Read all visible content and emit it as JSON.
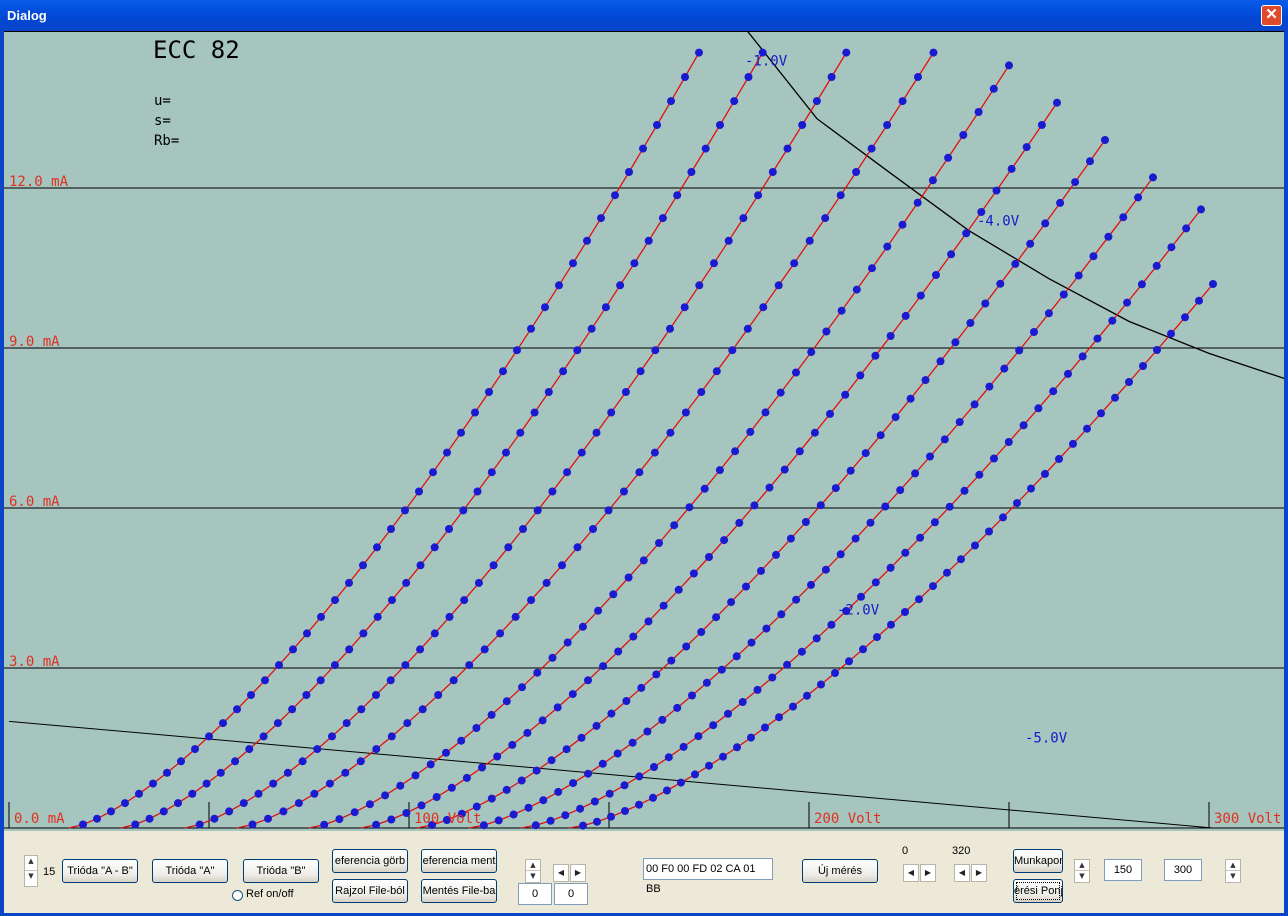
{
  "window": {
    "title": "Dialog"
  },
  "chart_data": {
    "type": "line",
    "title": "ECC 82",
    "params": {
      "u": "u=",
      "s": "s=",
      "rb": "Rb="
    },
    "xlim": [
      0,
      320
    ],
    "ylim": [
      0,
      15
    ],
    "x_ticks": [
      0,
      50,
      100,
      150,
      200,
      250,
      300
    ],
    "x_tick_labels": [
      {
        "x": 0,
        "label": "0.0 mA"
      },
      {
        "x": 100,
        "label": "100 Volt"
      },
      {
        "x": 200,
        "label": "200 Volt"
      },
      {
        "x": 300,
        "label": "300 Volt"
      }
    ],
    "y_gridlines": [
      {
        "y": 3,
        "label": "3.0 mA"
      },
      {
        "y": 6,
        "label": "6.0 mA"
      },
      {
        "y": 9,
        "label": "9.0 mA"
      },
      {
        "y": 12,
        "label": "12.0 mA"
      }
    ],
    "series": [
      {
        "x0": 15,
        "x_end": 176,
        "y_end": 15
      },
      {
        "x0": 28,
        "x_end": 192,
        "y_end": 15
      },
      {
        "x0": 44,
        "x_end": 213,
        "y_end": 15
      },
      {
        "x0": 57,
        "x_end": 235,
        "y_end": 15
      },
      {
        "x0": 75,
        "x_end": 250,
        "y_end": 14.3
      },
      {
        "x0": 88,
        "x_end": 262,
        "y_end": 13.6
      },
      {
        "x0": 102,
        "x_end": 274,
        "y_end": 12.9
      },
      {
        "x0": 115,
        "x_end": 286,
        "y_end": 12.2
      },
      {
        "x0": 128,
        "x_end": 298,
        "y_end": 11.6
      },
      {
        "x0": 140,
        "x_end": 301,
        "y_end": 10.2
      }
    ],
    "annotations": [
      {
        "text": "-1.0V",
        "x": 184,
        "y": 14.3
      },
      {
        "text": "-4.0V",
        "x": 242,
        "y": 11.3
      },
      {
        "text": "-2.0V",
        "x": 207,
        "y": 4.0
      },
      {
        "text": "-5.0V",
        "x": 254,
        "y": 1.6
      }
    ],
    "load_line": {
      "x": [
        0,
        301
      ],
      "y": [
        2.0,
        0
      ]
    },
    "power_curve": [
      [
        184,
        15
      ],
      [
        202,
        13.3
      ],
      [
        220,
        12.3
      ],
      [
        240,
        11.2
      ],
      [
        260,
        10.3
      ],
      [
        280,
        9.5
      ],
      [
        300,
        8.9
      ],
      [
        320,
        8.4
      ]
    ],
    "colors": {
      "background": "#a6c5bf",
      "curve": "#e01010",
      "marker": "#1a1ad0",
      "axis_label": "#e03020",
      "annotation": "#1818c8",
      "grid": "#000000"
    }
  },
  "controls": {
    "spin_value": "15",
    "btn_trioda_ab": "Trióda \"A - B\"",
    "btn_trioda_a": "Trióda  \"A\"",
    "btn_trioda_b": "Trióda  \"B\"",
    "btn_ref_gorbe": "eferencia görb",
    "btn_ref_mentes": "eferencia ment",
    "btn_rajzol": "Rajzol File-ból",
    "btn_mentes": "Mentés File-ba",
    "radio_ref": "Ref on/off",
    "edit_a": "0",
    "edit_b": "0",
    "hex_field": "00 F0 00 FD 02 CA 01 BB",
    "btn_uj": "Új mérés",
    "range_min": "0",
    "range_max": "320",
    "btn_munkapont": "Munkapon",
    "btn_meresi": "érési Ponj",
    "edit_150": "150",
    "edit_300": "300"
  }
}
